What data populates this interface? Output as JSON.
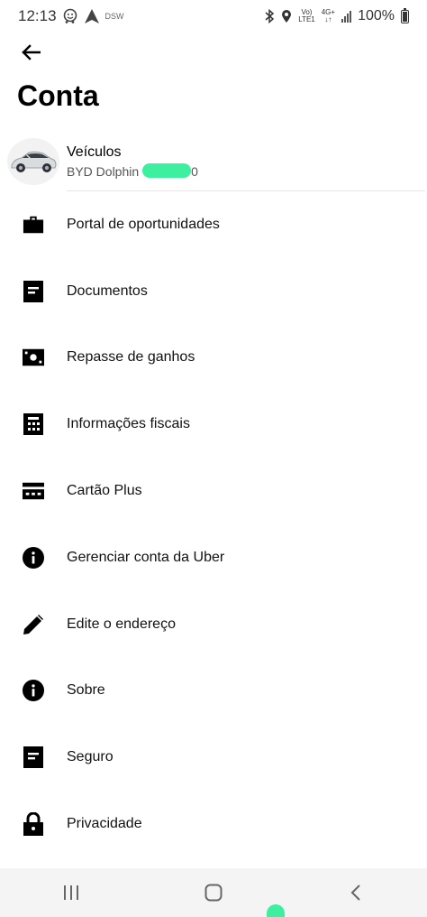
{
  "status_bar": {
    "time": "12:13",
    "carrier_tag": "DSW",
    "network_top": "Vo)",
    "network_bottom": "LTE1",
    "data_top": "4G+",
    "battery_percent": "100%"
  },
  "header": {
    "title": "Conta"
  },
  "vehicle": {
    "title": "Veículos",
    "subtitle_prefix": "BYD Dolphin",
    "subtitle_suffix": "0"
  },
  "menu": [
    {
      "label": "Portal de oportunidades",
      "icon": "briefcase-icon"
    },
    {
      "label": "Documentos",
      "icon": "document-icon"
    },
    {
      "label": "Repasse de ganhos",
      "icon": "cash-icon"
    },
    {
      "label": "Informações fiscais",
      "icon": "calculator-icon"
    },
    {
      "label": "Cartão Plus",
      "icon": "card-icon"
    },
    {
      "label": "Gerenciar conta da Uber",
      "icon": "info-icon"
    },
    {
      "label": "Edite o endereço",
      "icon": "pencil-icon"
    },
    {
      "label": "Sobre",
      "icon": "info-icon"
    },
    {
      "label": "Seguro",
      "icon": "document-icon"
    },
    {
      "label": "Privacidade",
      "icon": "lock-icon"
    }
  ]
}
